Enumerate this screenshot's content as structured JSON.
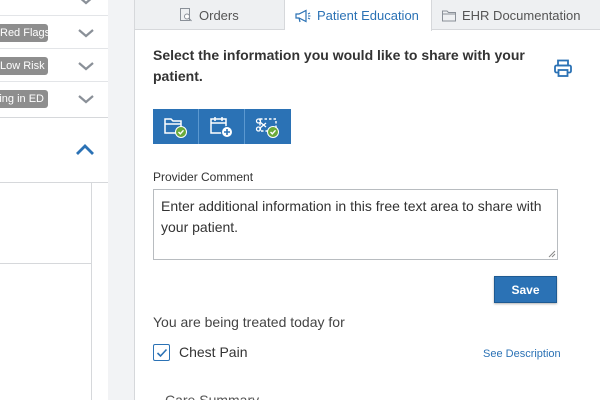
{
  "left_panel": {
    "flags": [
      {
        "label": "Red Flags"
      },
      {
        "label": "Low Risk"
      },
      {
        "label": "Waiting in ED"
      }
    ]
  },
  "tabs": [
    {
      "label": "Orders",
      "icon": "document-search-icon"
    },
    {
      "label": "Patient Education",
      "icon": "megaphone-icon"
    },
    {
      "label": "EHR Documentation",
      "icon": "folder-icon"
    }
  ],
  "active_tab": "Patient Education",
  "education": {
    "title": "Select the information you would like to share with your patient.",
    "share_buttons": [
      {
        "icon": "folder-check-icon"
      },
      {
        "icon": "calendar-add-icon"
      },
      {
        "icon": "scissors-check-icon"
      }
    ],
    "provider_comment_label": "Provider Comment",
    "provider_comment_value": "Enter additional information in this free text area to share with your patient.",
    "save_label": "Save",
    "treated_label": "You are being treated today for",
    "condition": {
      "label": "Chest Pain",
      "checked": true
    },
    "see_description_label": "See Description",
    "care_summary_label": "Care Summary"
  },
  "colors": {
    "accent": "#2b72b5",
    "flag_pill": "#8e8e8e",
    "check_badge": "#6aaa3a"
  }
}
